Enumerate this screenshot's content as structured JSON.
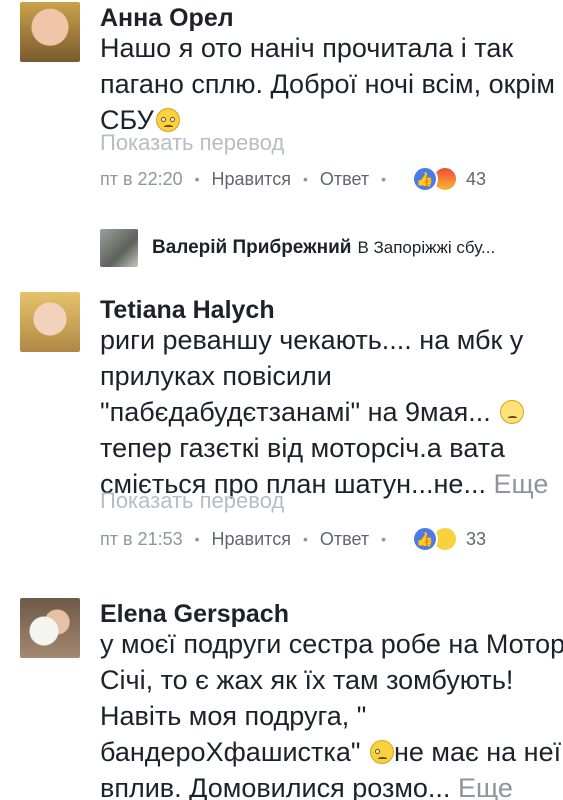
{
  "comments": [
    {
      "author": "Анна Орел",
      "lines": [
        "Нашо я ото наніч прочитала і так",
        "пагано сплю. Доброї ночі всім, окрім",
        "СБУ"
      ],
      "translate": "Показать перевод",
      "time": "пт в 22:20",
      "like": "Нравится",
      "reply": "Ответ",
      "reaction_icons": [
        "like-icon",
        "angry-icon"
      ],
      "reaction_count": "43"
    },
    {
      "author": "Tetiana Halych",
      "lines": [
        "риги реваншу чекають....  на мбк у",
        "прилуках повісили",
        "\"пабєдабудєтзанамі\" на 9мая...",
        "тепер газєткі від моторсіч.а вата",
        "сміється про план шатун...не..."
      ],
      "more": "Еще",
      "translate": "Показать перевод",
      "time": "пт в 21:53",
      "like": "Нравится",
      "reply": "Ответ",
      "reaction_icons": [
        "like-icon",
        "haha-icon"
      ],
      "reaction_count": "33"
    },
    {
      "author": "Elena Gerspach",
      "lines": [
        "у моєї подруги сестра робе на Мотор",
        "Січі, то є жах як їх там зомбують!",
        "Навіть моя подруга, \"",
        "бандероХфашистка\"",
        "не має на неї",
        "вплив. Домовилися розмо..."
      ],
      "more": "Еще"
    }
  ],
  "reply_preview": {
    "author": "Валерій Прибрежний",
    "text": "В Запоріжжі сбу..."
  }
}
